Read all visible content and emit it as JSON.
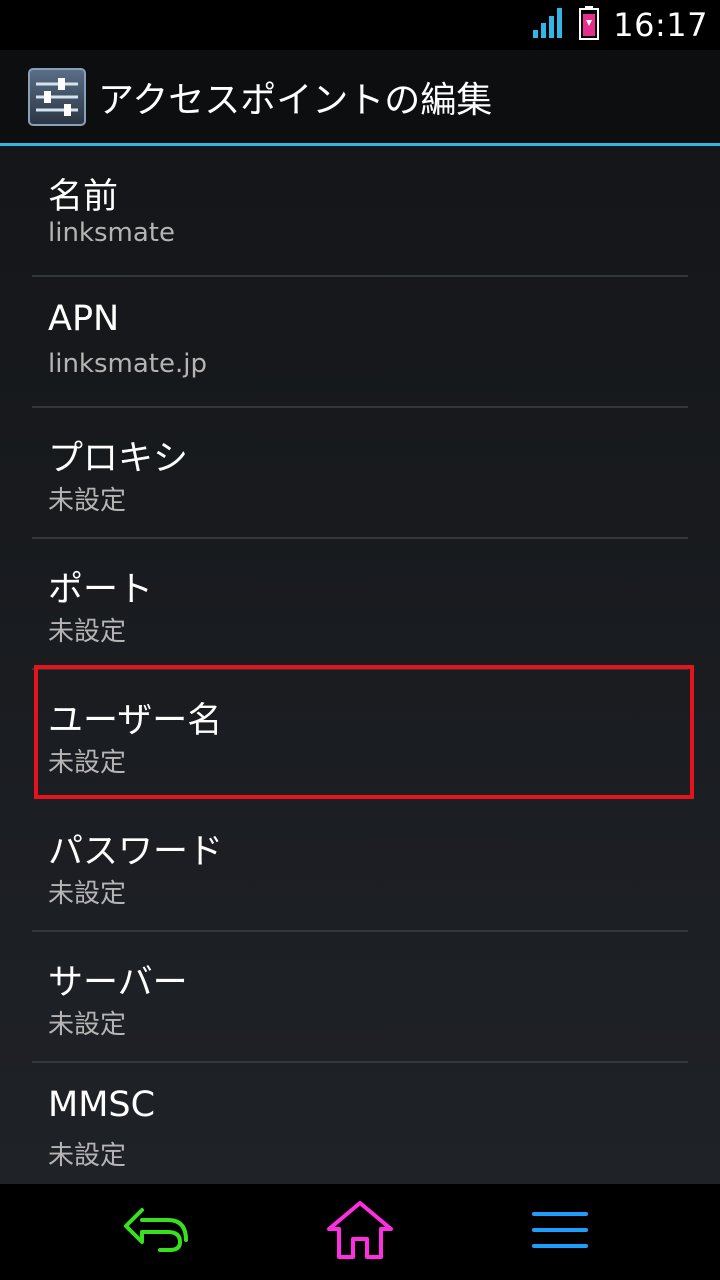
{
  "status_bar": {
    "time": "16:17",
    "signal_icon": "signal-strength-icon",
    "battery_icon": "battery-icon",
    "signal_color": "#33b5e5",
    "battery_color": "#e62e8c"
  },
  "action_bar": {
    "icon": "settings-sliders-icon",
    "title": "アクセスポイントの編集",
    "accent_color": "#33b5e5"
  },
  "list": {
    "items": [
      {
        "title": "名前",
        "value": "linksmate"
      },
      {
        "title": "APN",
        "value": "linksmate.jp"
      },
      {
        "title": "プロキシ",
        "value": "未設定"
      },
      {
        "title": "ポート",
        "value": "未設定"
      },
      {
        "title": "ユーザー名",
        "value": "未設定"
      },
      {
        "title": "パスワード",
        "value": "未設定"
      },
      {
        "title": "サーバー",
        "value": "未設定"
      },
      {
        "title": "MMSC",
        "value": "未設定"
      }
    ],
    "highlight_color": "#e3141c"
  },
  "nav_bar": {
    "back_icon": "back-arrow-icon",
    "home_icon": "home-icon",
    "menu_icon": "menu-icon",
    "back_color": "#39e01f",
    "home_color": "#ff2ee0",
    "menu_color": "#1e9dff"
  }
}
